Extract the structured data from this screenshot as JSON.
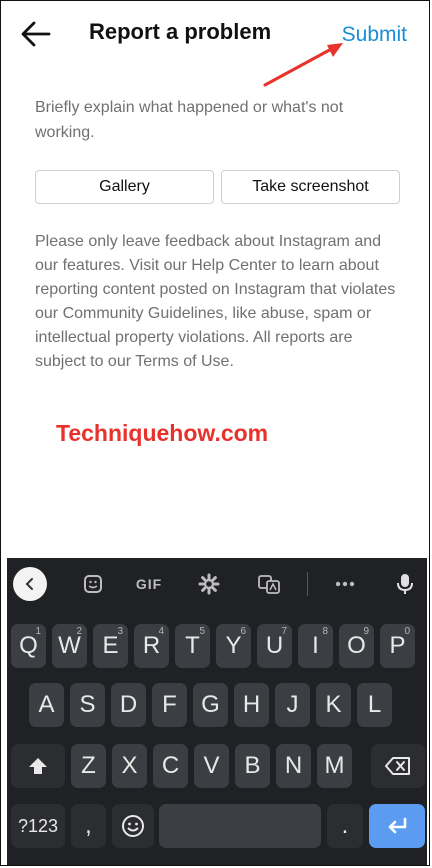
{
  "header": {
    "title": "Report a problem",
    "submit_label": "Submit"
  },
  "content": {
    "description": "Briefly explain what happened or what's not working.",
    "gallery_label": "Gallery",
    "screenshot_label": "Take screenshot",
    "notice": "Please only leave feedback about Instagram and our features. Visit our Help Center to learn about reporting content posted on Instagram that violates our Community Guidelines, like abuse, spam or intellectual property violations. All reports are subject to our Terms of Use."
  },
  "watermark": "Techniquehow.com",
  "annotation_color": "#e8322b",
  "accent_color": "#1a8cd8",
  "keyboard": {
    "toolbar": {
      "collapse_icon": "chevron-left-icon",
      "sticker_icon": "sticker-icon",
      "gif_label": "GIF",
      "settings_icon": "gear-icon",
      "translate_icon": "translate-icon",
      "more_icon": "more-icon",
      "mic_icon": "mic-icon"
    },
    "row1": [
      {
        "label": "Q",
        "hint": "1"
      },
      {
        "label": "W",
        "hint": "2"
      },
      {
        "label": "E",
        "hint": "3"
      },
      {
        "label": "R",
        "hint": "4"
      },
      {
        "label": "T",
        "hint": "5"
      },
      {
        "label": "Y",
        "hint": "6"
      },
      {
        "label": "U",
        "hint": "7"
      },
      {
        "label": "I",
        "hint": "8"
      },
      {
        "label": "O",
        "hint": "9"
      },
      {
        "label": "P",
        "hint": "0"
      }
    ],
    "row2": [
      "A",
      "S",
      "D",
      "F",
      "G",
      "H",
      "J",
      "K",
      "L"
    ],
    "row3": [
      "Z",
      "X",
      "C",
      "V",
      "B",
      "N",
      "M"
    ],
    "row4": {
      "symbols": "?123",
      "comma": ",",
      "period": "."
    }
  }
}
